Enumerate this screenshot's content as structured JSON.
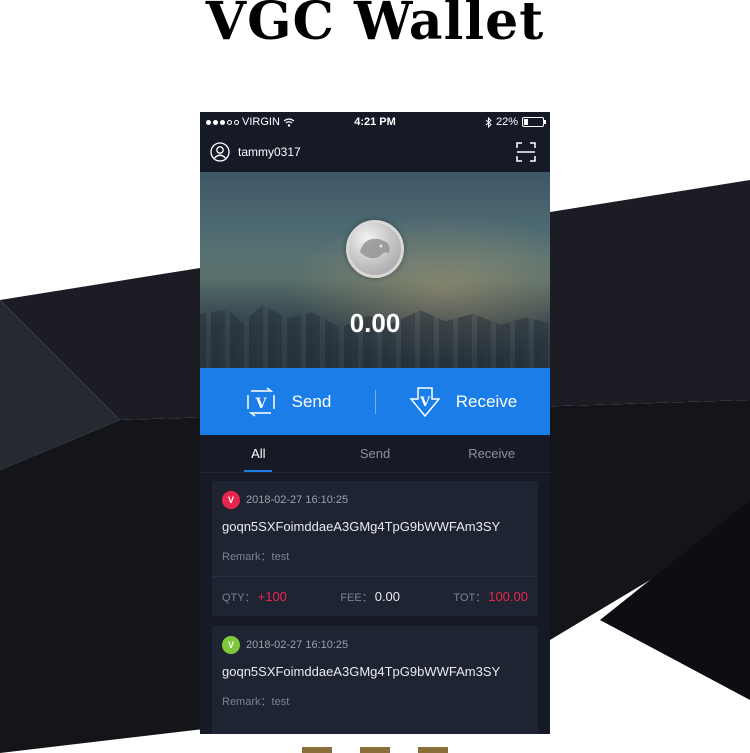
{
  "headline": "VGC Wallet",
  "status_bar": {
    "carrier": "VIRGIN",
    "time": "4:21 PM",
    "battery": "22%",
    "battery_level": 0.22
  },
  "header": {
    "username": "tammy0317",
    "icons": [
      "user-icon",
      "scan-icon"
    ]
  },
  "wallet": {
    "balance": "0.00",
    "coin_icon": "panther-coin-icon"
  },
  "actions": {
    "send_label": "Send",
    "receive_label": "Receive"
  },
  "tabs": [
    {
      "label": "All",
      "active": true
    },
    {
      "label": "Send",
      "active": false
    },
    {
      "label": "Receive",
      "active": false
    }
  ],
  "transactions": [
    {
      "type": "send",
      "badge_color": "#e8264b",
      "date": "2018-02-27 16:10:25",
      "address": "goqn5SXFoimddaeA3GMg4TpG9bWWFAm3SY",
      "remark_label": "Remark：",
      "remark": "test",
      "qty_label": "QTY：",
      "qty": "+100",
      "fee_label": "FEE：",
      "fee": "0.00",
      "tot_label": "TOT：",
      "tot": "100.00"
    },
    {
      "type": "receive",
      "badge_color": "#7dc93a",
      "date": "2018-02-27 16:10:25",
      "address": "goqn5SXFoimddaeA3GMg4TpG9bWWFAm3SY",
      "remark_label": "Remark：",
      "remark": "test"
    }
  ],
  "colors": {
    "accent": "#1a7de8",
    "background": "#161a26",
    "card": "#1f2433",
    "negative": "#e8264b"
  }
}
